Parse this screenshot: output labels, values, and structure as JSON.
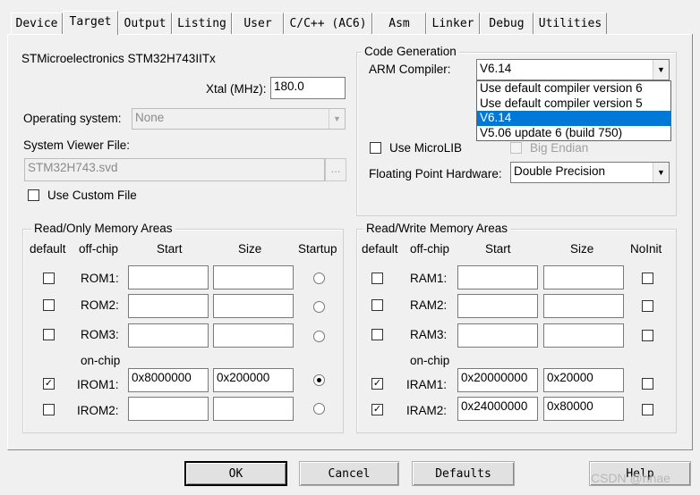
{
  "tabs": [
    "Device",
    "Target",
    "Output",
    "Listing",
    "User",
    "C/C++ (AC6)",
    "Asm",
    "Linker",
    "Debug",
    "Utilities"
  ],
  "active_tab": "Target",
  "device_name": "STMicroelectronics STM32H743IITx",
  "xtal": {
    "label": "Xtal (MHz):",
    "value": "180.0"
  },
  "os": {
    "label": "Operating system:",
    "value": "None"
  },
  "svf": {
    "label": "System Viewer File:",
    "value": "STM32H743.svd",
    "browse": "..."
  },
  "custom_file": {
    "label": "Use Custom File",
    "checked": false
  },
  "codegen": {
    "title": "Code Generation",
    "compiler_label": "ARM Compiler:",
    "compiler_value": "V6.14",
    "options": [
      "Use default compiler version 6",
      "Use default compiler version 5",
      "V6.14",
      "V5.06 update 6 (build 750)"
    ],
    "selected_index": 2,
    "microlib": {
      "label": "Use MicroLIB",
      "checked": false
    },
    "bigendian": {
      "label": "Big Endian",
      "checked": false
    },
    "fpu_label": "Floating Point Hardware:",
    "fpu_value": "Double Precision"
  },
  "rom": {
    "title": "Read/Only Memory Areas",
    "headers": {
      "default": "default",
      "offchip": "off-chip",
      "start": "Start",
      "size": "Size",
      "startup": "Startup"
    },
    "onchip_label": "on-chip",
    "rows": [
      {
        "label": "ROM1:",
        "start": "",
        "size": "",
        "default": false,
        "startup": false
      },
      {
        "label": "ROM2:",
        "start": "",
        "size": "",
        "default": false,
        "startup": false
      },
      {
        "label": "ROM3:",
        "start": "",
        "size": "",
        "default": false,
        "startup": false
      },
      {
        "label": "IROM1:",
        "start": "0x8000000",
        "size": "0x200000",
        "default": true,
        "startup": true
      },
      {
        "label": "IROM2:",
        "start": "",
        "size": "",
        "default": false,
        "startup": false
      }
    ]
  },
  "ram": {
    "title": "Read/Write Memory Areas",
    "headers": {
      "default": "default",
      "offchip": "off-chip",
      "start": "Start",
      "size": "Size",
      "noinit": "NoInit"
    },
    "onchip_label": "on-chip",
    "rows": [
      {
        "label": "RAM1:",
        "start": "",
        "size": "",
        "default": false,
        "noinit": false
      },
      {
        "label": "RAM2:",
        "start": "",
        "size": "",
        "default": false,
        "noinit": false
      },
      {
        "label": "RAM3:",
        "start": "",
        "size": "",
        "default": false,
        "noinit": false
      },
      {
        "label": "IRAM1:",
        "start": "0x20000000",
        "size": "0x20000",
        "default": true,
        "noinit": false
      },
      {
        "label": "IRAM2:",
        "start": "0x24000000",
        "size": "0x80000",
        "default": true,
        "noinit": false
      }
    ]
  },
  "buttons": {
    "ok": "OK",
    "cancel": "Cancel",
    "defaults": "Defaults",
    "help": "Help"
  },
  "watermark": "CSDN @hhae"
}
